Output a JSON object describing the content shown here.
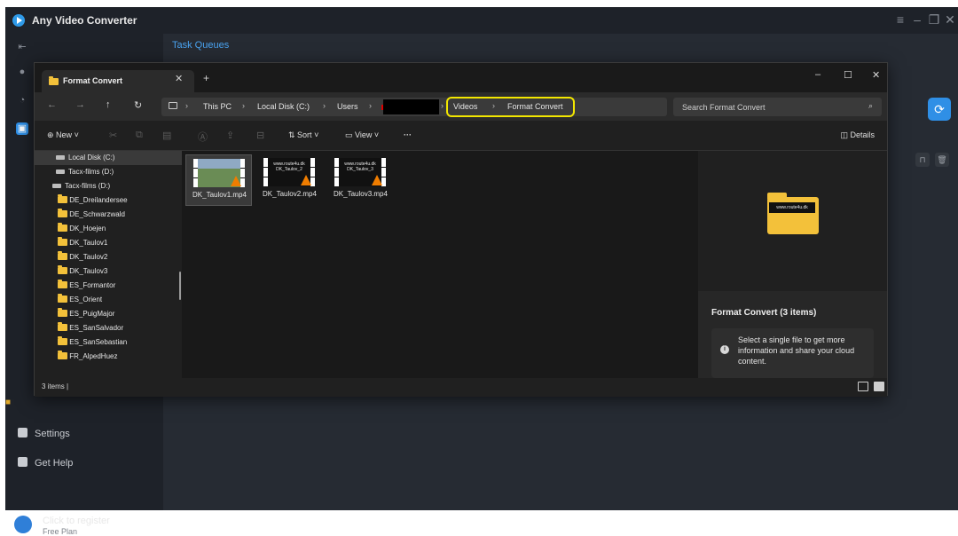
{
  "app": {
    "title": "Any Video Converter",
    "tab": "Task Queues",
    "register_title": "Click to register",
    "register_sub": "Free Plan",
    "settings_label": "Settings",
    "help_label": "Get Help"
  },
  "explorer": {
    "tab_label": "Format Convert",
    "breadcrumb": [
      "This PC",
      "Local Disk (C:)",
      "Users",
      "Videos",
      "Format Convert"
    ],
    "search_placeholder": "Search Format Convert",
    "toolbar": {
      "new": "New",
      "sort": "Sort",
      "view": "View",
      "more": "···",
      "details": "Details"
    },
    "nav": [
      {
        "label": "Local Disk (C:)",
        "type": "drive",
        "selected": true
      },
      {
        "label": "Tacx-films (D:)",
        "type": "drive"
      },
      {
        "label": "Tacx-films (D:)",
        "type": "drive"
      },
      {
        "label": "DE_Dreilandersee",
        "type": "folder"
      },
      {
        "label": "DE_Schwarzwald",
        "type": "folder"
      },
      {
        "label": "DK_Hoejen",
        "type": "folder"
      },
      {
        "label": "DK_Taulov1",
        "type": "folder"
      },
      {
        "label": "DK_Taulov2",
        "type": "folder"
      },
      {
        "label": "DK_Taulov3",
        "type": "folder"
      },
      {
        "label": "ES_Formantor",
        "type": "folder"
      },
      {
        "label": "ES_Orient",
        "type": "folder"
      },
      {
        "label": "ES_PuigMajor",
        "type": "folder"
      },
      {
        "label": "ES_SanSalvador",
        "type": "folder"
      },
      {
        "label": "ES_SanSebastian",
        "type": "folder"
      },
      {
        "label": "FR_AlpedHuez",
        "type": "folder"
      }
    ],
    "files": [
      {
        "name": "DK_Taulov1.mp4",
        "selected": true,
        "thumb_text": ""
      },
      {
        "name": "DK_Taulov2.mp4",
        "selected": false,
        "thumb_text": "www.route4u.dk DK_Taulov_2"
      },
      {
        "name": "DK_Taulov3.mp4",
        "selected": false,
        "thumb_text": "www.route4u.dk DK_Taulov_3"
      }
    ],
    "preview": {
      "folder_text": "www.route4u.dk",
      "title": "Format Convert (3 items)",
      "message": "Select a single file to get more information and share your cloud content."
    },
    "status": "3 items  |"
  }
}
